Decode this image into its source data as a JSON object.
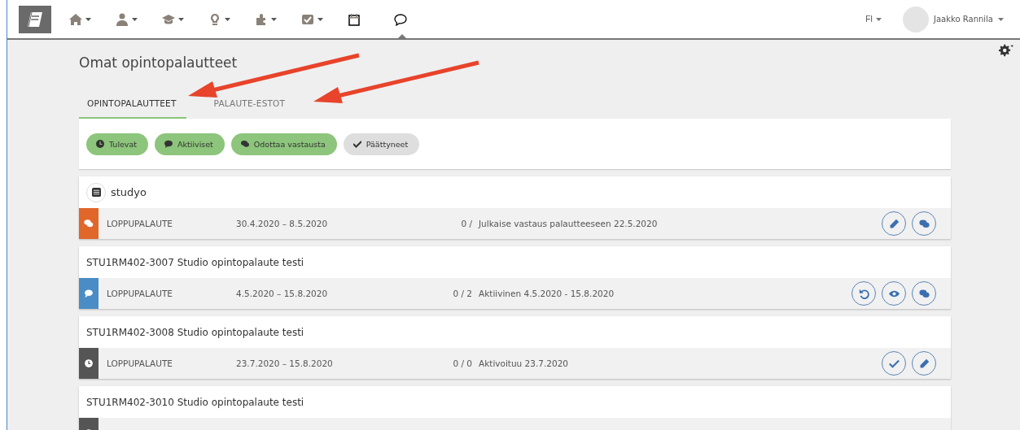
{
  "nav": {
    "items": [
      {
        "kind": "home",
        "caret": true,
        "selected": false
      },
      {
        "kind": "person",
        "caret": true,
        "selected": false
      },
      {
        "kind": "cap",
        "caret": true,
        "selected": false
      },
      {
        "kind": "bulb",
        "caret": true,
        "selected": false
      },
      {
        "kind": "puzzle",
        "caret": true,
        "selected": false
      },
      {
        "kind": "checkbox",
        "caret": true,
        "selected": false
      },
      {
        "kind": "calendar",
        "caret": false,
        "selected": false
      },
      {
        "kind": "chat",
        "caret": false,
        "selected": true
      }
    ],
    "language": "FI",
    "user": "Jaakko Rannila"
  },
  "page": {
    "title": "Omat opintopalautteet"
  },
  "tabs": [
    {
      "label": "OPINTOPALAUTTEET",
      "selected": true
    },
    {
      "label": "PALAUTE-ESTOT",
      "selected": false
    }
  ],
  "filters": [
    {
      "label": "Tulevat",
      "kind": "clock",
      "selected": true
    },
    {
      "label": "Aktiiviset",
      "kind": "comment",
      "selected": true
    },
    {
      "label": "Odottaa vastausta",
      "kind": "comments",
      "selected": true
    },
    {
      "label": "Päättyneet",
      "kind": "check",
      "selected": false
    }
  ],
  "courses": [
    {
      "title": "studyo",
      "kind": "group",
      "row": {
        "kind": "awaiting",
        "type": "LOPPUPALAUTE",
        "dates": "30.4.2020 – 8.5.2020",
        "count": "0 /",
        "info": "Julkaise vastaus palautteeseen 22.5.2020",
        "actions": [
          {
            "kind": "edit"
          },
          {
            "kind": "comments"
          }
        ]
      }
    },
    {
      "title": "STU1RM402-3007 Studio opintopalaute testi",
      "kind": "course",
      "row": {
        "kind": "active",
        "type": "LOPPUPALAUTE",
        "dates": "4.5.2020 – 15.8.2020",
        "count": "0 / 2",
        "info": "Aktiivinen 4.5.2020 - 15.8.2020",
        "actions": [
          {
            "kind": "undo"
          },
          {
            "kind": "view"
          },
          {
            "kind": "comments"
          }
        ]
      }
    },
    {
      "title": "STU1RM402-3008 Studio opintopalaute testi",
      "kind": "course",
      "row": {
        "kind": "upcoming",
        "type": "LOPPUPALAUTE",
        "dates": "23.7.2020 – 15.8.2020",
        "count": "0 / 0",
        "info": "Aktivoituu 23.7.2020",
        "actions": [
          {
            "kind": "check"
          },
          {
            "kind": "edit"
          }
        ]
      }
    },
    {
      "title": "STU1RM402-3010 Studio opintopalaute testi",
      "kind": "course",
      "row": {
        "kind": "upcoming"
      }
    }
  ]
}
